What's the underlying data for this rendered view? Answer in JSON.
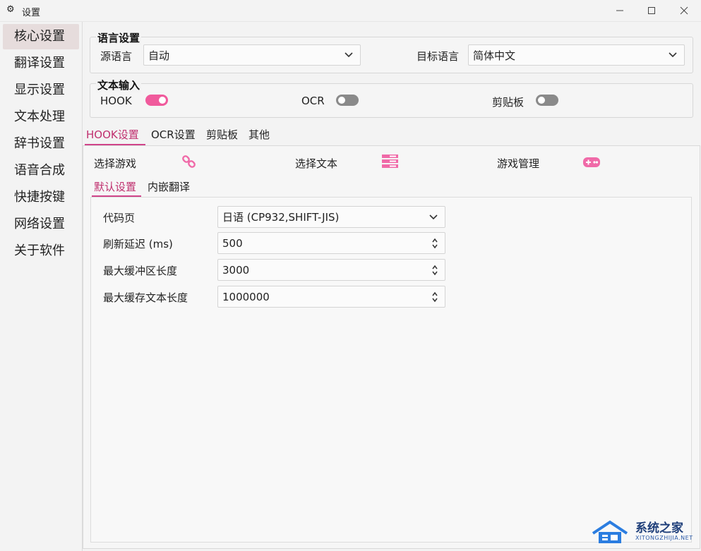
{
  "window": {
    "title": "设置",
    "icon": "gear-icon"
  },
  "sidebar": {
    "items": [
      {
        "label": "核心设置",
        "active": true
      },
      {
        "label": "翻译设置"
      },
      {
        "label": "显示设置"
      },
      {
        "label": "文本处理"
      },
      {
        "label": "辞书设置"
      },
      {
        "label": "语音合成"
      },
      {
        "label": "快捷按键"
      },
      {
        "label": "网络设置"
      },
      {
        "label": "关于软件"
      }
    ]
  },
  "language": {
    "group_title": "语言设置",
    "source_label": "源语言",
    "source_value": "自动",
    "target_label": "目标语言",
    "target_value": "简体中文"
  },
  "text_input": {
    "group_title": "文本输入",
    "hook_label": "HOOK",
    "hook_on": true,
    "ocr_label": "OCR",
    "ocr_on": false,
    "clipboard_label": "剪贴板",
    "clipboard_on": false
  },
  "tabs": [
    {
      "label": "HOOK设置",
      "active": true
    },
    {
      "label": "OCR设置"
    },
    {
      "label": "剪贴板"
    },
    {
      "label": "其他"
    }
  ],
  "hook": {
    "select_game_label": "选择游戏",
    "select_text_label": "选择文本",
    "game_manage_label": "游戏管理",
    "subtabs": [
      {
        "label": "默认设置",
        "active": true
      },
      {
        "label": "内嵌翻译"
      }
    ],
    "settings": {
      "codepage_label": "代码页",
      "codepage_value": "日语 (CP932,SHIFT-JIS)",
      "refresh_label": "刷新延迟 (ms)",
      "refresh_value": "500",
      "buffer_label": "最大缓冲区长度",
      "buffer_value": "3000",
      "cache_label": "最大缓存文本长度",
      "cache_value": "1000000"
    }
  },
  "watermark": {
    "text": "系统之家",
    "sub": "XITONGZHIJIA.NET"
  },
  "colors": {
    "accent": "#f05a9c",
    "tab_active": "#c0306f",
    "icon_pink": "#f06aa8"
  }
}
